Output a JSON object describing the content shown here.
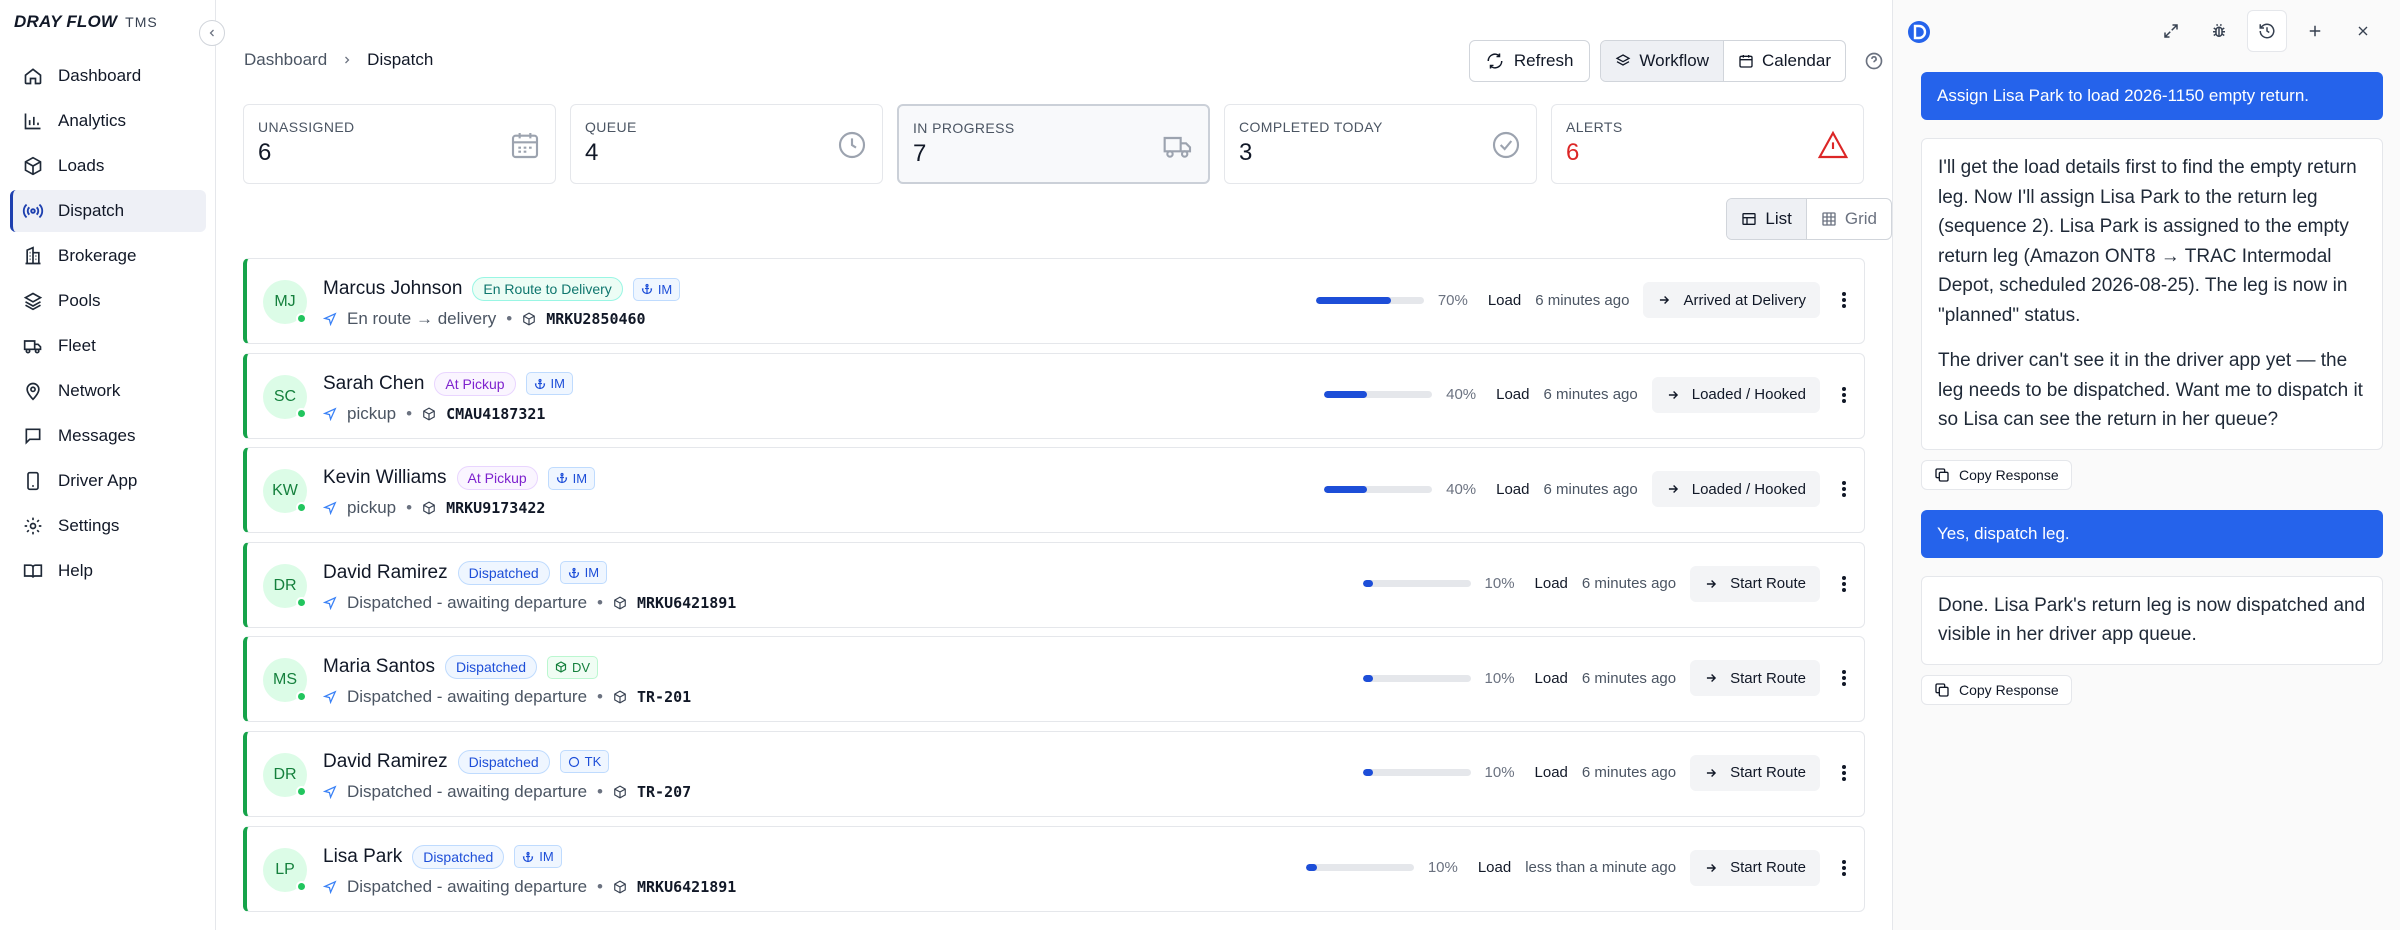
{
  "brand": {
    "name": "DRAY FLOW",
    "suffix": "TMS"
  },
  "sidebar": {
    "items": [
      {
        "label": "Dashboard",
        "icon": "home-icon"
      },
      {
        "label": "Analytics",
        "icon": "bar-chart-icon"
      },
      {
        "label": "Loads",
        "icon": "package-icon"
      },
      {
        "label": "Dispatch",
        "icon": "radio-icon",
        "active": true
      },
      {
        "label": "Brokerage",
        "icon": "building-icon"
      },
      {
        "label": "Pools",
        "icon": "layers-icon"
      },
      {
        "label": "Fleet",
        "icon": "truck-icon"
      },
      {
        "label": "Network",
        "icon": "map-pin-icon"
      },
      {
        "label": "Messages",
        "icon": "message-icon"
      },
      {
        "label": "Driver App",
        "icon": "phone-icon"
      },
      {
        "label": "Settings",
        "icon": "gear-icon"
      },
      {
        "label": "Help",
        "icon": "book-icon"
      }
    ]
  },
  "breadcrumb": {
    "root": "Dashboard",
    "current": "Dispatch"
  },
  "toolbar": {
    "refresh": "Refresh",
    "workflow": "Workflow",
    "calendar": "Calendar"
  },
  "stats": [
    {
      "label": "UNASSIGNED",
      "value": "6",
      "icon": "calendar-icon"
    },
    {
      "label": "QUEUE",
      "value": "4",
      "icon": "clock-icon"
    },
    {
      "label": "IN PROGRESS",
      "value": "7",
      "icon": "truck-icon",
      "active": true
    },
    {
      "label": "COMPLETED TODAY",
      "value": "3",
      "icon": "check-circle-icon"
    },
    {
      "label": "ALERTS",
      "value": "6",
      "icon": "alert-triangle-icon",
      "alert": true
    }
  ],
  "view_toggle": {
    "list": "List",
    "grid": "Grid"
  },
  "loads": [
    {
      "initials": "MJ",
      "name": "Marcus Johnson",
      "status": "En Route to Delivery",
      "status_color": "teal",
      "tag": "IM",
      "tag_color": "blue",
      "tag_icon": "anchor-icon",
      "detail": "En route → delivery",
      "container": "MRKU2850460",
      "progress": 70,
      "progress_label": "70%",
      "type": "Load",
      "time": "6 minutes ago",
      "action": "Arrived at Delivery"
    },
    {
      "initials": "SC",
      "name": "Sarah Chen",
      "status": "At Pickup",
      "status_color": "purple",
      "tag": "IM",
      "tag_color": "blue",
      "tag_icon": "anchor-icon",
      "detail": "pickup",
      "container": "CMAU4187321",
      "progress": 40,
      "progress_label": "40%",
      "type": "Load",
      "time": "6 minutes ago",
      "action": "Loaded / Hooked"
    },
    {
      "initials": "KW",
      "name": "Kevin Williams",
      "status": "At Pickup",
      "status_color": "purple",
      "tag": "IM",
      "tag_color": "blue",
      "tag_icon": "anchor-icon",
      "detail": "pickup",
      "container": "MRKU9173422",
      "progress": 40,
      "progress_label": "40%",
      "type": "Load",
      "time": "6 minutes ago",
      "action": "Loaded / Hooked"
    },
    {
      "initials": "DR",
      "name": "David Ramirez",
      "status": "Dispatched",
      "status_color": "blue",
      "tag": "IM",
      "tag_color": "blue",
      "tag_icon": "anchor-icon",
      "detail": "Dispatched - awaiting departure",
      "container": "MRKU6421891",
      "progress": 10,
      "progress_label": "10%",
      "type": "Load",
      "time": "6 minutes ago",
      "action": "Start Route"
    },
    {
      "initials": "MS",
      "name": "Maria Santos",
      "status": "Dispatched",
      "status_color": "blue",
      "tag": "DV",
      "tag_color": "green",
      "tag_icon": "box-icon",
      "detail": "Dispatched - awaiting departure",
      "container": "TR-201",
      "progress": 10,
      "progress_label": "10%",
      "type": "Load",
      "time": "6 minutes ago",
      "action": "Start Route"
    },
    {
      "initials": "DR",
      "name": "David Ramirez",
      "status": "Dispatched",
      "status_color": "blue",
      "tag": "TK",
      "tag_color": "blue",
      "tag_icon": "circle-icon",
      "detail": "Dispatched - awaiting departure",
      "container": "TR-207",
      "progress": 10,
      "progress_label": "10%",
      "type": "Load",
      "time": "6 minutes ago",
      "action": "Start Route"
    },
    {
      "initials": "LP",
      "name": "Lisa Park",
      "status": "Dispatched",
      "status_color": "blue",
      "tag": "IM",
      "tag_color": "blue",
      "tag_icon": "anchor-icon",
      "detail": "Dispatched - awaiting departure",
      "container": "MRKU6421891",
      "progress": 10,
      "progress_label": "10%",
      "type": "Load",
      "time": "less than a minute ago",
      "action": "Start Route"
    }
  ],
  "chat": {
    "messages": [
      {
        "role": "user",
        "text": "Assign Lisa Park to load 2026-1150 empty return."
      },
      {
        "role": "assistant",
        "paragraphs": [
          "I'll get the load details first to find the empty return leg. Now I'll assign Lisa Park to the return leg (sequence 2). Lisa Park is assigned to the empty return leg (Amazon ONT8 → TRAC Intermodal Depot, scheduled 2026-08-25). The leg is now in \"planned\" status.",
          "The driver can't see it in the driver app yet — the leg needs to be dispatched. Want me to dispatch it so Lisa can see the return in her queue?"
        ],
        "copy_label": "Copy Response"
      },
      {
        "role": "user",
        "text": "Yes, dispatch leg."
      },
      {
        "role": "assistant",
        "paragraphs": [
          "Done. Lisa Park's return leg is now dispatched and visible in her driver app queue."
        ],
        "copy_label": "Copy Response"
      }
    ]
  },
  "colors": {
    "accent": "#2563eb",
    "row_border": "#16a34a",
    "alert": "#dc2626"
  }
}
